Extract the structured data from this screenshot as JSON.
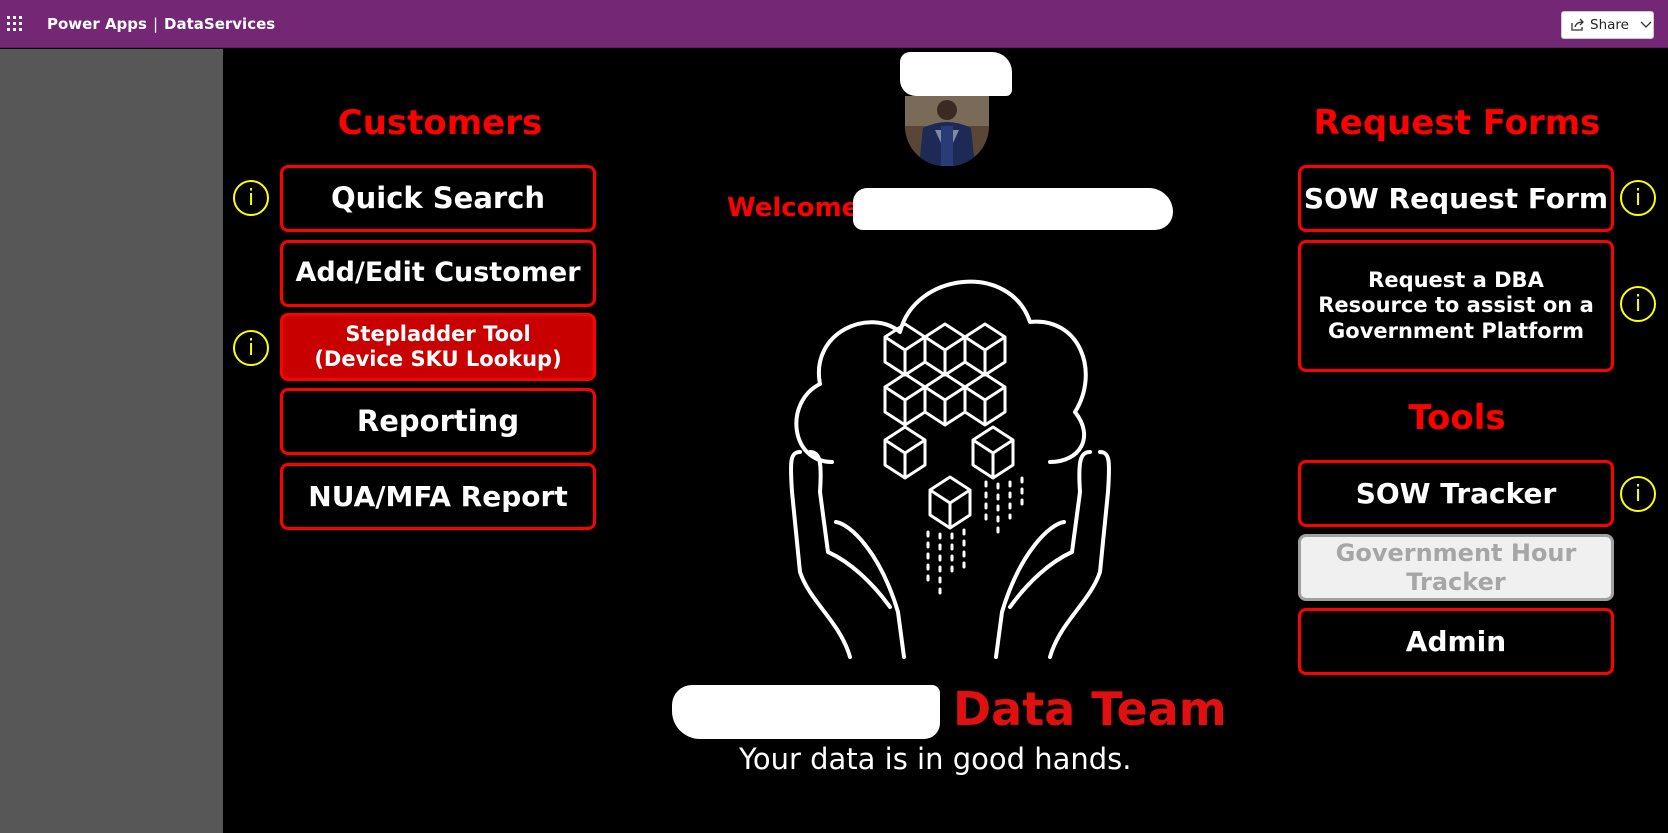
{
  "topbar": {
    "app_name": "Power Apps",
    "separator": "|",
    "environment": "DataServices",
    "share_label": "Share"
  },
  "customers": {
    "title": "Customers",
    "buttons": [
      "Quick Search",
      "Add/Edit Customer",
      "Stepladder Tool\n(Device SKU Lookup)",
      "Reporting",
      "NUA/MFA Report"
    ]
  },
  "welcome": {
    "label": "Welcome"
  },
  "branding": {
    "team": "Data Team",
    "tagline": "Your data is in good hands."
  },
  "request_forms": {
    "title": "Request Forms",
    "buttons": [
      "SOW Request Form",
      "Request a DBA Resource to assist on a Government Platform"
    ]
  },
  "tools": {
    "title": "Tools",
    "buttons": [
      "SOW Tracker",
      "Government Hour Tracker",
      "Admin"
    ]
  },
  "info_glyph": "i",
  "colors": {
    "topbar": "#742774",
    "accent_red": "#ff0000",
    "info_yellow": "#ffff00",
    "canvas": "#000000",
    "gutter": "#575757"
  },
  "icons": {
    "app_launcher": "waffle-icon",
    "share": "share-icon",
    "chevron": "chevron-down-icon",
    "info": "info-icon",
    "logo": "cloud-hands-cubes-logo"
  }
}
